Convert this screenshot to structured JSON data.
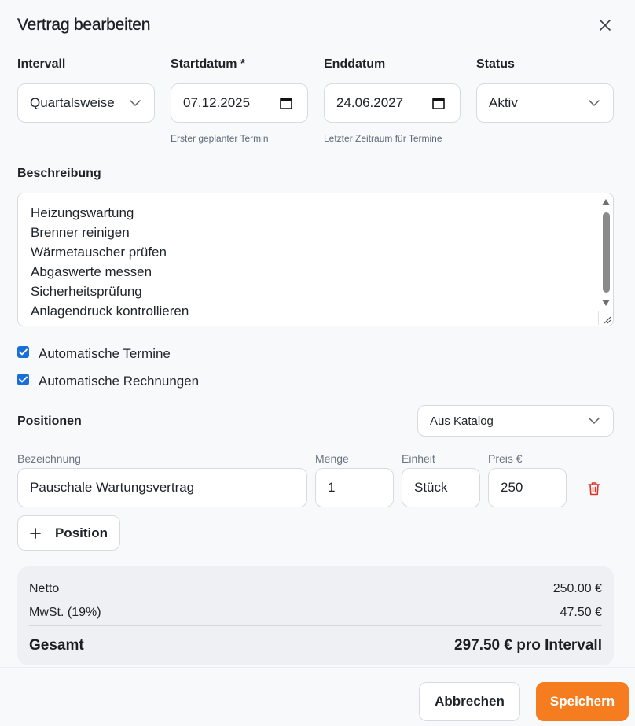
{
  "dialog": {
    "title": "Vertrag bearbeiten"
  },
  "fields": {
    "interval": {
      "label": "Intervall",
      "value": "Quartalsweise"
    },
    "start_date": {
      "label": "Startdatum *",
      "value": "07.12.2025",
      "hint": "Erster geplanter Termin"
    },
    "end_date": {
      "label": "Enddatum",
      "value": "24.06.2027",
      "hint": "Letzter Zeitraum für Termine"
    },
    "status": {
      "label": "Status",
      "value": "Aktiv"
    }
  },
  "description": {
    "label": "Beschreibung",
    "lines": [
      "Heizungswartung",
      "Brenner reinigen",
      "Wärmetauscher prüfen",
      "Abgaswerte messen",
      "Sicherheitsprüfung",
      "Anlagendruck kontrollieren"
    ]
  },
  "options": {
    "auto_appointments": {
      "label": "Automatische Termine",
      "checked": true
    },
    "auto_invoices": {
      "label": "Automatische Rechnungen",
      "checked": true
    }
  },
  "positions": {
    "label": "Positionen",
    "catalog_select": "Aus Katalog",
    "columns": {
      "name": "Bezeichnung",
      "qty": "Menge",
      "unit": "Einheit",
      "price": "Preis €"
    },
    "items": [
      {
        "name": "Pauschale Wartungsvertrag",
        "qty": "1",
        "unit": "Stück",
        "price": "250"
      }
    ],
    "add_button": "Position"
  },
  "summary": {
    "net_label": "Netto",
    "net_value": "250.00 €",
    "vat_label": "MwSt. (19%)",
    "vat_value": "47.50 €",
    "total_label": "Gesamt",
    "total_value": "297.50 € pro Intervall"
  },
  "footer": {
    "cancel": "Abbrechen",
    "save": "Speichern"
  },
  "colors": {
    "primary": "#f57c1f",
    "checkbox": "#1a6ed8",
    "delete": "#d9342b"
  },
  "icons": {
    "close": "close-icon",
    "chevron": "chevron-down-icon",
    "calendar": "calendar-icon",
    "trash": "trash-icon",
    "plus": "plus-icon"
  }
}
